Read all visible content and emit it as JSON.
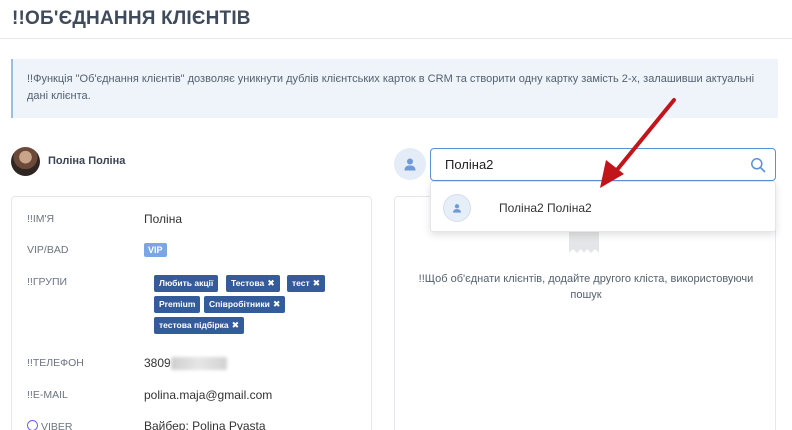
{
  "page": {
    "title": "!!ОБ'ЄДНАННЯ КЛІЄНТІВ"
  },
  "info": {
    "text": "!!Функція \"Об'єднання клієнтів\" дозволяє уникнути дублів клієнтських карток в CRM та створити одну картку замість 2-х, залашивши актуальні дані клієнта."
  },
  "client_left": {
    "name": "Поліна Поліна",
    "fields": {
      "name_label": "!!ІМ'Я",
      "name_value": "Поліна",
      "vip_label": "VIP/BAD",
      "vip_value": "VIP",
      "groups_label": "!!ГРУПИ",
      "groups": [
        "Любить акції",
        "Тестова",
        "тест",
        "Premium",
        "Співробітники",
        "тестова підбірка"
      ],
      "phone_label": "!!ТЕЛЕФОН",
      "phone_value": "3809",
      "email_label": "!!E-MAIL",
      "email_value": "polina.maja@gmail.com",
      "viber_label": "VIBER",
      "viber_value": "Вайбер: Polina Pyasta"
    }
  },
  "search": {
    "value": "Поліна2",
    "placeholder": ""
  },
  "dropdown": {
    "items": [
      {
        "label": "Поліна2 Поліна2"
      }
    ]
  },
  "client_right": {
    "empty_text": "!!Щоб об'єднати клієнтів, додайте другого кліста, використовуючи пошук"
  },
  "colors": {
    "accent": "#355c9a",
    "arrow": "#c0161b",
    "focus_border": "#5a90d6",
    "vip": "#7aa7e3"
  }
}
